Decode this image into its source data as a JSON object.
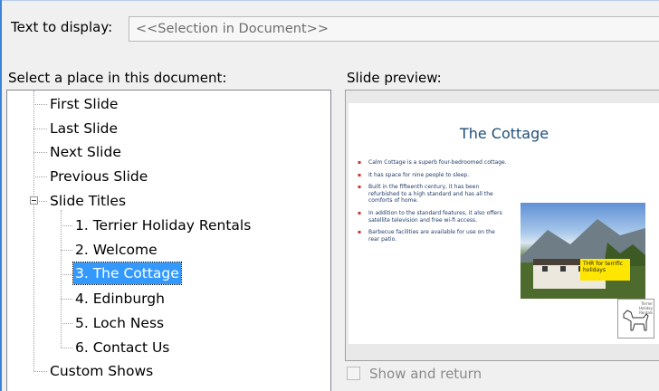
{
  "text_to_display": {
    "label": "Text to display:",
    "value": "<<Selection in Document>>"
  },
  "place": {
    "label": "Select a place in this document:",
    "tree": {
      "first": "First Slide",
      "last": "Last Slide",
      "next": "Next Slide",
      "previous": "Previous Slide",
      "titles_group": "Slide Titles",
      "titles": [
        "1. Terrier Holiday Rentals",
        "2. Welcome",
        "3. The Cottage",
        "4. Edinburgh",
        "5. Loch Ness",
        "6. Contact Us"
      ],
      "custom": "Custom Shows"
    },
    "selected": "3. The Cottage"
  },
  "preview": {
    "label": "Slide preview:",
    "slide": {
      "title": "The Cottage",
      "bullets": [
        "Calm Cottage is a superb four-bedroomed cottage.",
        "It has space for nine people to sleep.",
        "Built in the fifteenth century, it has been refurbished to a high standard and has all the comforts of home.",
        "In addition to the standard features, it also offers satellite television and free wi-fi access.",
        "Barbecue facilities are available for use on the rear patio."
      ],
      "photo_caption": "THR for terrific holidays",
      "logo_text": "Terrier Holiday Rentals"
    }
  },
  "show_and_return": {
    "label": "Show and return",
    "checked": false
  },
  "colors": {
    "selection": "#3399ff",
    "slide_title": "#1f4e79",
    "caption_bg": "#ffe600"
  }
}
